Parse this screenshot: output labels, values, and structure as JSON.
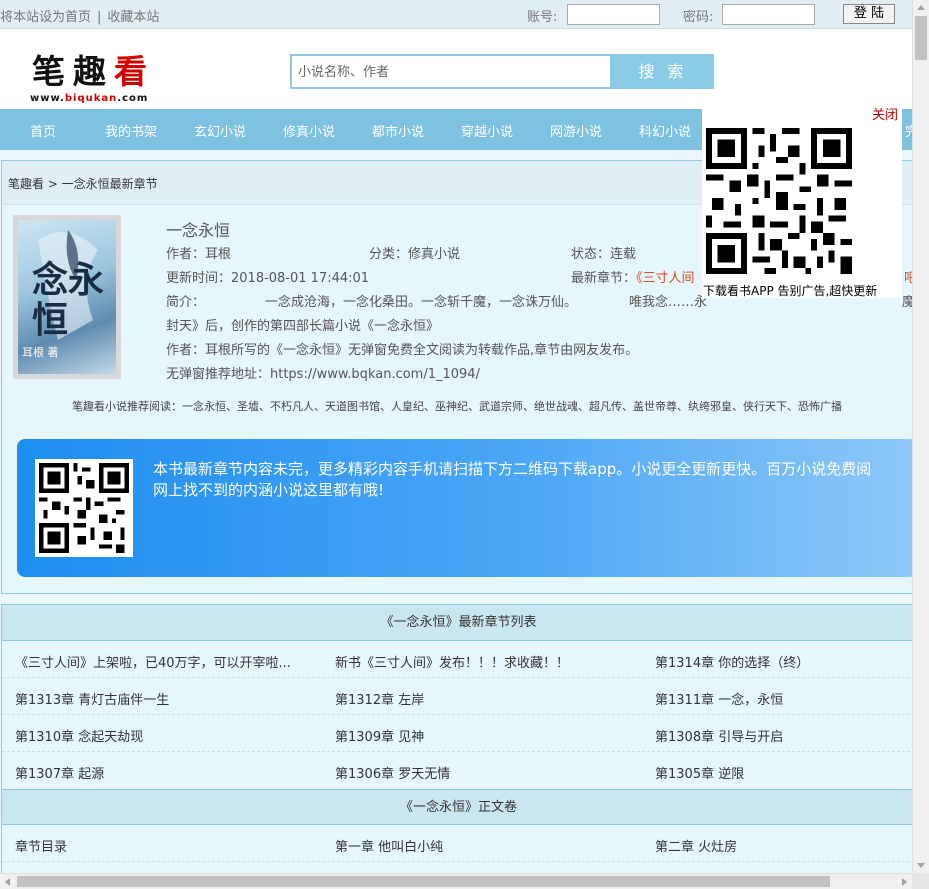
{
  "topbar": {
    "set_home": "将本站设为首页",
    "bookmark": "收藏本站",
    "account_label": "账号:",
    "password_label": "密码:",
    "login_button": "登 陆"
  },
  "logo": {
    "text_black": "笔趣",
    "text_red": "看",
    "url_prefix": "www.",
    "url_red": "biqukan",
    "url_suffix": ".com"
  },
  "search": {
    "placeholder": "小说名称、作者",
    "button": "搜 索"
  },
  "nav": [
    "首页",
    "我的书架",
    "玄幻小说",
    "修真小说",
    "都市小说",
    "穿越小说",
    "网游小说",
    "科幻小说",
    "完"
  ],
  "breadcrumb": "笔趣看 > 一念永恒最新章节",
  "book": {
    "title": "一念永恒",
    "author": "作者：耳根",
    "category": "分类：修真小说",
    "status": "状态：连载",
    "update_time": "更新时间：2018-08-01 17:44:01",
    "latest_label": "最新章节：",
    "latest_value": "《三寸人间",
    "latest_tail": "吧",
    "intro_label": "简介：",
    "intro_line1": "一念成沧海，一念化桑田。一念斩千魔，一念诛万仙。",
    "intro_line1b": "唯我念……永",
    "intro_line1c": "魔",
    "intro_line2": "封天》后，创作的第四部长篇小说《一念永恒》",
    "note": "作者：耳根所写的《一念永恒》无弹窗免费全文阅读为转载作品,章节由网友发布。",
    "url_line": "无弹窗推荐地址：https://www.bqkan.com/1_1094/",
    "cover_big": "念永恒",
    "cover_small": "耳根 著"
  },
  "recommend": "笔趣看小说推荐阅读：一念永恒、圣墟、不朽凡人、天道图书馆、人皇纪、巫神纪、武道宗师、绝世战魂、超凡传、盖世帝尊、纨绔邪皇、侠行天下、恐怖广播",
  "banner": {
    "line1": "本书最新章节内容未完，更多精彩内容手机请扫描下方二维码下载app。小说更全更新更快。百万小说免费阅",
    "line2": "网上找不到的内涵小说这里都有哦!"
  },
  "latest_list": {
    "header": "《一念永恒》最新章节列表",
    "rows": [
      [
        "《三寸人间》上架啦，已40万字，可以开宰啦...",
        "新书《三寸人间》发布！！！求收藏！！",
        "第1314章 你的选择（终）"
      ],
      [
        "第1313章 青灯古庙伴一生",
        "第1312章 左岸",
        "第1311章 一念，永恒"
      ],
      [
        "第1310章 念起天劫现",
        "第1309章 见神",
        "第1308章 引导与开启"
      ],
      [
        "第1307章 起源",
        "第1306章 罗天无情",
        "第1305章 逆限"
      ]
    ]
  },
  "main_list": {
    "header": "《一念永恒》正文卷",
    "rows": [
      [
        "章节目录",
        "第一章 他叫白小纯",
        "第二章 火灶房"
      ]
    ]
  },
  "popup": {
    "close": "关闭",
    "caption": "下载看书APP 告别广告,超快更新"
  },
  "colors": {
    "nav_bg": "#7ec2e2",
    "search_button": "#8ccbe5",
    "page_bg": "#eaf8fe",
    "banner_start": "#1d8df1",
    "banner_end": "#8ec8f8",
    "latest_chapter": "#e04a1a",
    "close_link": "#bb0000"
  }
}
